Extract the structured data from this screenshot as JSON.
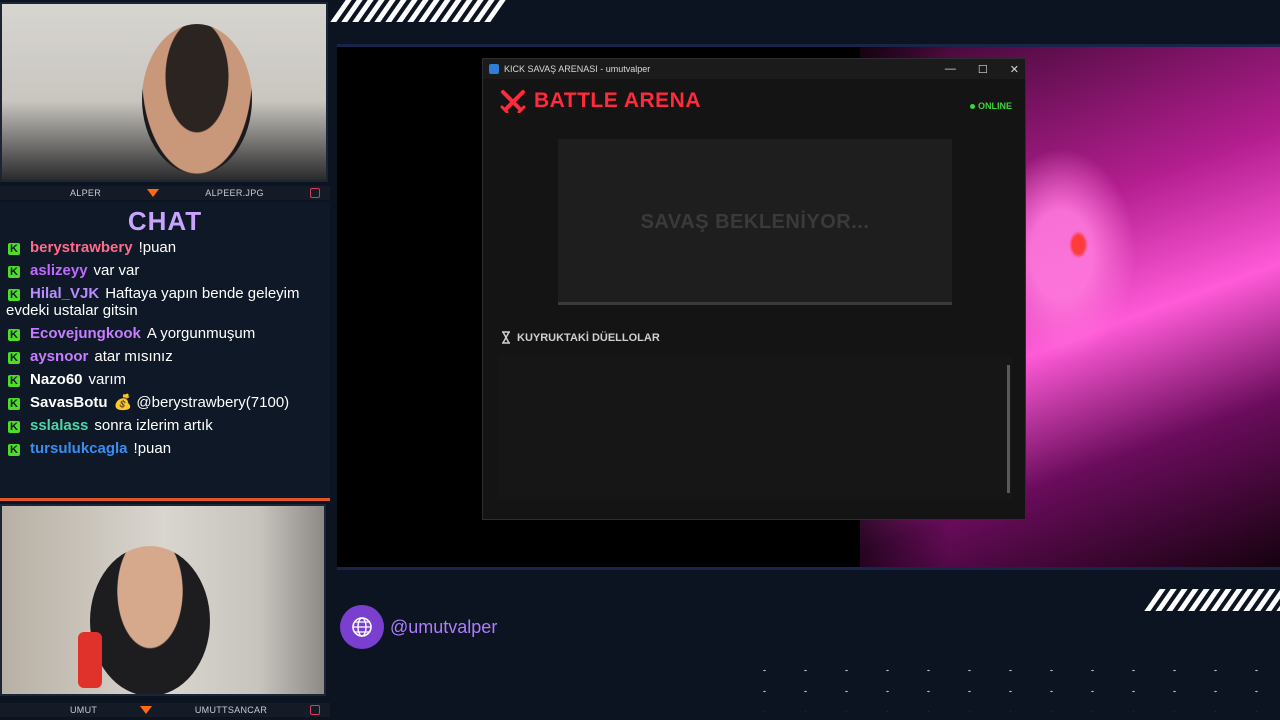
{
  "cams": {
    "top": {
      "left_label": "ALPER",
      "right_label": "ALPEER.JPG"
    },
    "bottom": {
      "left_label": "UMUT",
      "right_label": "UMUTTSANCAR"
    }
  },
  "chat": {
    "title": "CHAT",
    "messages": [
      {
        "user": "berystrawbery",
        "color": "#ff6b8a",
        "text": "!puan"
      },
      {
        "user": "aslizeyy",
        "color": "#c06bff",
        "text": "var var"
      },
      {
        "user": "Hilal_VJK",
        "color": "#b98cff",
        "text": "Haftaya yapın bende geleyim evdeki ustalar gitsin"
      },
      {
        "user": "Ecovejungkook",
        "color": "#c77dff",
        "text": "A yorgunmuşum"
      },
      {
        "user": "aysnoor",
        "color": "#c77dff",
        "text": "atar mısınız"
      },
      {
        "user": "Nazo60",
        "color": "#ffffff",
        "text": "varım"
      },
      {
        "user": "SavasBotu",
        "color": "#ffffff",
        "text": "💰 @berystrawbery(7100)"
      },
      {
        "user": "sslalass",
        "color": "#4fd6a6",
        "text": "sonra izlerim artık"
      },
      {
        "user": "tursulukcagla",
        "color": "#3a8df0",
        "text": "!puan"
      }
    ]
  },
  "window": {
    "title": "KICK SAVAŞ ARENASI - umutvalper",
    "arena_title": "BATTLE ARENA",
    "status": "ONLINE",
    "waiting_text": "SAVAŞ BEKLENİYOR...",
    "queue_title": "KUYRUKTAKİ DÜELLOLAR"
  },
  "footer": {
    "handle": "@umutvalper"
  },
  "icons": {
    "app": "app-icon",
    "swords": "crossed-swords-icon",
    "hourglass": "hourglass-icon",
    "globe": "globe-icon"
  },
  "colors": {
    "arena_red": "#ff2a3c",
    "online_green": "#3ed43c",
    "kick_green": "#4ede2a",
    "accent_purple": "#7b3fd0"
  }
}
